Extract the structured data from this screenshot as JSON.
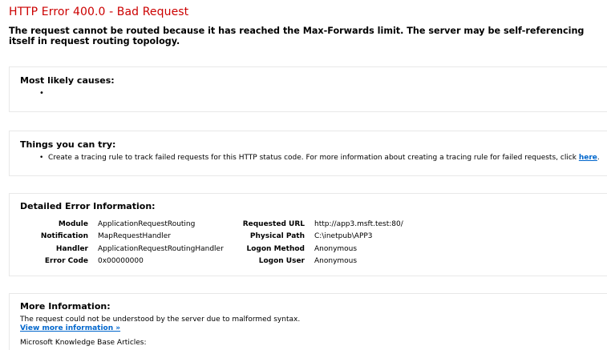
{
  "title": "HTTP Error 400.0 - Bad Request",
  "summary": "The request cannot be routed because it has reached the Max-Forwards limit. The server may be self-referencing itself in request routing topology.",
  "causes": {
    "heading": "Most likely causes:",
    "bullet": "•"
  },
  "try": {
    "heading": "Things you can try:",
    "bullet": "•",
    "text": "Create a tracing rule to track failed requests for this HTTP status code. For more information about creating a tracing rule for failed requests, click ",
    "link": "here",
    "after": "."
  },
  "details": {
    "heading": "Detailed Error Information:",
    "left": [
      {
        "key": "Module",
        "value": "ApplicationRequestRouting"
      },
      {
        "key": "Notification",
        "value": "MapRequestHandler"
      },
      {
        "key": "Handler",
        "value": "ApplicationRequestRoutingHandler"
      },
      {
        "key": "Error Code",
        "value": "0x00000000"
      }
    ],
    "right": [
      {
        "key": "Requested URL",
        "value": "http://app3.msft.test:80/"
      },
      {
        "key": "Physical Path",
        "value": "C:\\inetpub\\APP3"
      },
      {
        "key": "Logon Method",
        "value": "Anonymous"
      },
      {
        "key": "Logon User",
        "value": "Anonymous"
      }
    ]
  },
  "more": {
    "heading": "More Information:",
    "text": "The request could not be understood by the server due to malformed syntax.",
    "link": "View more information »",
    "kb": "Microsoft Knowledge Base Articles:"
  }
}
